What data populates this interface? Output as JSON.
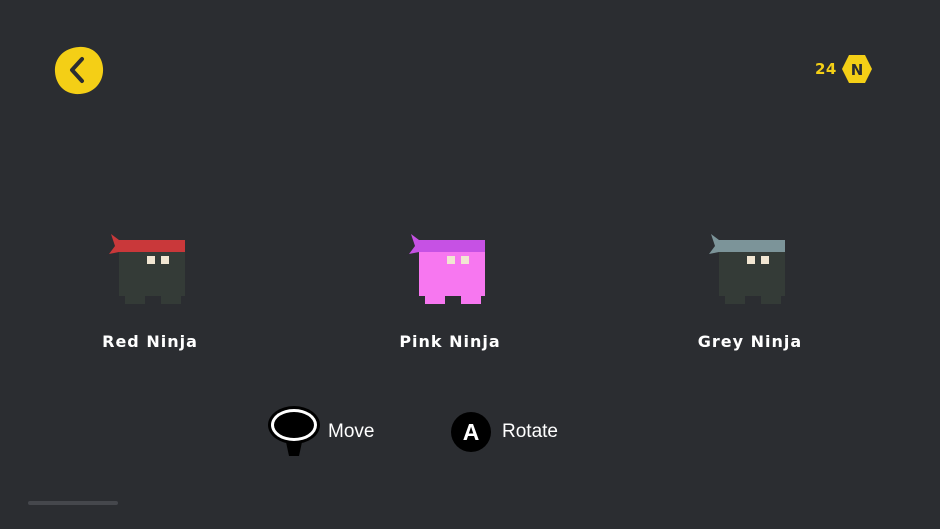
{
  "header": {
    "back_icon": "chevron-left-icon",
    "coin_count": "24",
    "coin_icon": "hexagon-n-coin-icon",
    "coin_letter": "N",
    "accent_color": "#f4cf16"
  },
  "ninjas": [
    {
      "name": "Red Ninja",
      "body_color": "#343b37",
      "band_color": "#c9383a",
      "eye_color": "#f1e6d2"
    },
    {
      "name": "Pink Ninja",
      "body_color": "#f777f0",
      "band_color": "#c651e4",
      "eye_color": "#f1e6d2"
    },
    {
      "name": "Grey Ninja",
      "body_color": "#343b37",
      "band_color": "#7c9499",
      "eye_color": "#f1e6d2"
    }
  ],
  "controls": [
    {
      "icon": "thumbstick-icon",
      "label": "Move"
    },
    {
      "icon": "a-button-icon",
      "glyph": "A",
      "label": "Rotate"
    }
  ],
  "background_color": "#2b2d31"
}
